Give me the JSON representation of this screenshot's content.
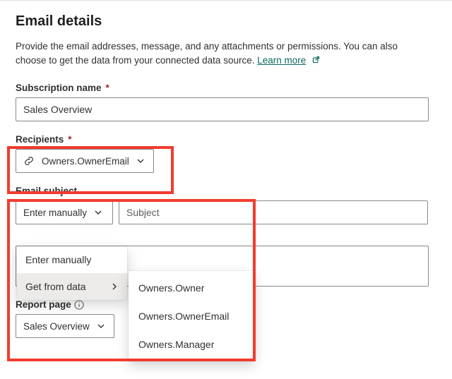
{
  "header": {
    "title": "Email details",
    "description_a": "Provide the email addresses, message, and any attachments or permissions. You can also choose to get the data from your connected data source. ",
    "learn_more": "Learn more"
  },
  "fields": {
    "subscription_name": {
      "label": "Subscription name",
      "value": "Sales Overview",
      "required": true
    },
    "recipients": {
      "label": "Recipients",
      "required": true,
      "chip_value": "Owners.OwnerEmail"
    },
    "email_subject": {
      "label": "Email subject",
      "mode_selector": "Enter manually",
      "placeholder": "Subject"
    },
    "report_page": {
      "label": "Report page",
      "value": "Sales Overview"
    }
  },
  "dropdown": {
    "primary": {
      "items": [
        {
          "label": "Enter manually",
          "has_sub": false
        },
        {
          "label": "Get from data",
          "has_sub": true,
          "hovered": true
        }
      ]
    },
    "secondary": {
      "items": [
        {
          "label": "Owners.Owner"
        },
        {
          "label": "Owners.OwnerEmail"
        },
        {
          "label": "Owners.Manager"
        }
      ]
    }
  }
}
